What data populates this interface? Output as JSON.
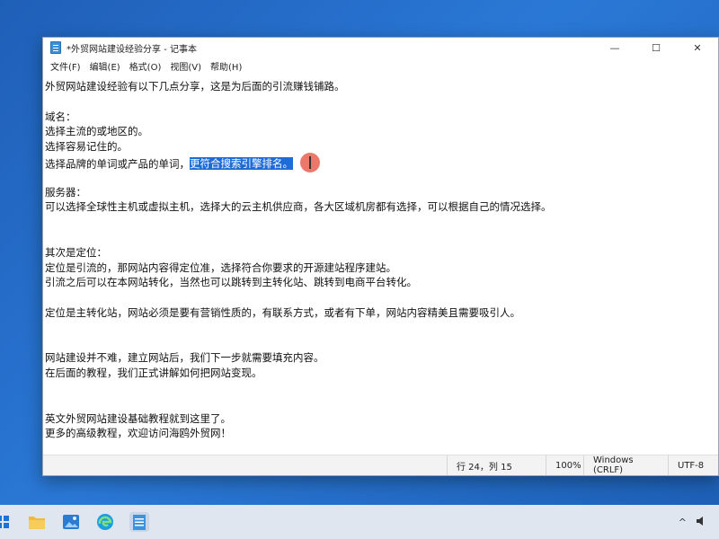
{
  "window": {
    "title": "*外贸网站建设经验分享 - 记事本",
    "controls": {
      "minimize": "—",
      "maximize": "☐",
      "close": "✕"
    }
  },
  "menu": [
    {
      "label": "文件(F)"
    },
    {
      "label": "编辑(E)"
    },
    {
      "label": "格式(O)"
    },
    {
      "label": "视图(V)"
    },
    {
      "label": "帮助(H)"
    }
  ],
  "document": {
    "lines": [
      "外贸网站建设经验有以下几点分享，这是为后面的引流赚钱铺路。",
      "",
      "域名：",
      "选择主流的或地区的。",
      "选择容易记住的。",
      {
        "before": "选择品牌的单词或产品的单词，",
        "selected": "更符合搜索引擎排名。"
      },
      "",
      "服务器：",
      "可以选择全球性主机或虚拟主机，选择大的云主机供应商，各大区域机房都有选择，可以根据自己的情况选择。",
      "",
      "",
      "其次是定位：",
      "定位是引流的，那网站内容得定位准，选择符合你要求的开源建站程序建站。",
      "引流之后可以在本网站转化，当然也可以跳转到主转化站、跳转到电商平台转化。",
      "",
      "定位是主转化站，网站必须是要有营销性质的，有联系方式，或者有下单，网站内容精美且需要吸引人。",
      "",
      "",
      "网站建设并不难，建立网站后，我们下一步就需要填充内容。",
      "在后面的教程，我们正式讲解如何把网站变现。",
      "",
      "",
      "英文外贸网站建设基础教程就到这里了。",
      "更多的高级教程，欢迎访问海鸥外贸网！"
    ]
  },
  "status": {
    "position": "行 24，列 15",
    "zoom": "100%",
    "line_ending": "Windows (CRLF)",
    "encoding": "UTF-8"
  },
  "taskbar": {
    "icons": [
      "start-icon",
      "file-explorer-icon",
      "photos-icon",
      "edge-browser-icon",
      "notepad-icon"
    ],
    "tray_chevron": "^"
  }
}
